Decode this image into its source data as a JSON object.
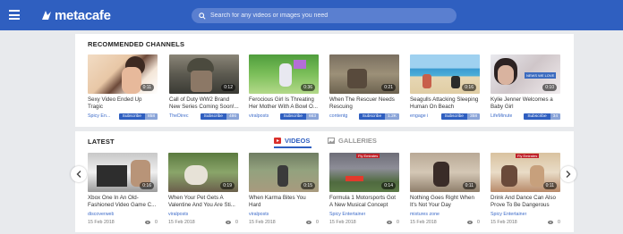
{
  "header": {
    "logo_text": "metacafe",
    "search_placeholder": "Search for any videos or images you need"
  },
  "recommended": {
    "title": "RECOMMENDED CHANNELS",
    "subscribe_label": "Subscribe",
    "items": [
      {
        "title": "Sexy Video Ended Up Tragic",
        "duration": "0:11",
        "channel": "Spicy En...",
        "subs": "858"
      },
      {
        "title": "Call of Duty WW2 Brand New Series Coming Soon!...",
        "duration": "0:12",
        "channel": "TheDirec",
        "subs": "486"
      },
      {
        "title": "Ferocious Girl Is Threating Her Mother With A Bowl O...",
        "duration": "0:36",
        "channel": "viralposts",
        "subs": "663"
      },
      {
        "title": "When The Rescuer Needs Rescuing",
        "duration": "0:21",
        "channel": "contentg",
        "subs": "1.2K"
      },
      {
        "title": "Seagulls Attacking Sleeping Human On Beach",
        "duration": "0:16",
        "channel": "engage i",
        "subs": "358"
      },
      {
        "title": "Kylie Jenner Welcomes a Baby Girl",
        "duration": "0:10",
        "channel": "LifeMinute",
        "subs": "34",
        "overlay": "NEWS WE LOVE"
      }
    ]
  },
  "latest": {
    "title": "LATEST",
    "tabs": {
      "videos": "VIDEOS",
      "galleries": "GALLERIES"
    },
    "items": [
      {
        "title": "Xbox One In An Old-Fashioned Video Game C...",
        "duration": "0:16",
        "channel": "discoverweb",
        "date": "15 Feb 2018",
        "views": "0"
      },
      {
        "title": "When Your Pet Gets A Valentine And You Are Sti...",
        "duration": "0:19",
        "channel": "viralposts",
        "date": "15 Feb 2018",
        "views": "0"
      },
      {
        "title": "When Karma Bites You Hard",
        "duration": "0:15",
        "channel": "viralposts",
        "date": "15 Feb 2018",
        "views": "0"
      },
      {
        "title": "Formula 1 Motorsports Got A New Musical Concept",
        "duration": "0:14",
        "channel": "Spicy Entertainer",
        "date": "15 Feb 2018",
        "views": "0",
        "overlay": "Fly Emirates"
      },
      {
        "title": "Nothing Goes Right When It's Not Your Day",
        "duration": "0:11",
        "channel": "mixtures zone",
        "date": "15 Feb 2018",
        "views": "0"
      },
      {
        "title": "Drink And Dance Can Also Prove To Be Dangerous",
        "duration": "0:11",
        "channel": "Spicy Entertainer",
        "date": "15 Feb 2018",
        "views": "0",
        "overlay": "Fly Emirates"
      }
    ]
  },
  "colors": {
    "brand": "#2f5fc0",
    "accent_red": "#d9302c"
  }
}
